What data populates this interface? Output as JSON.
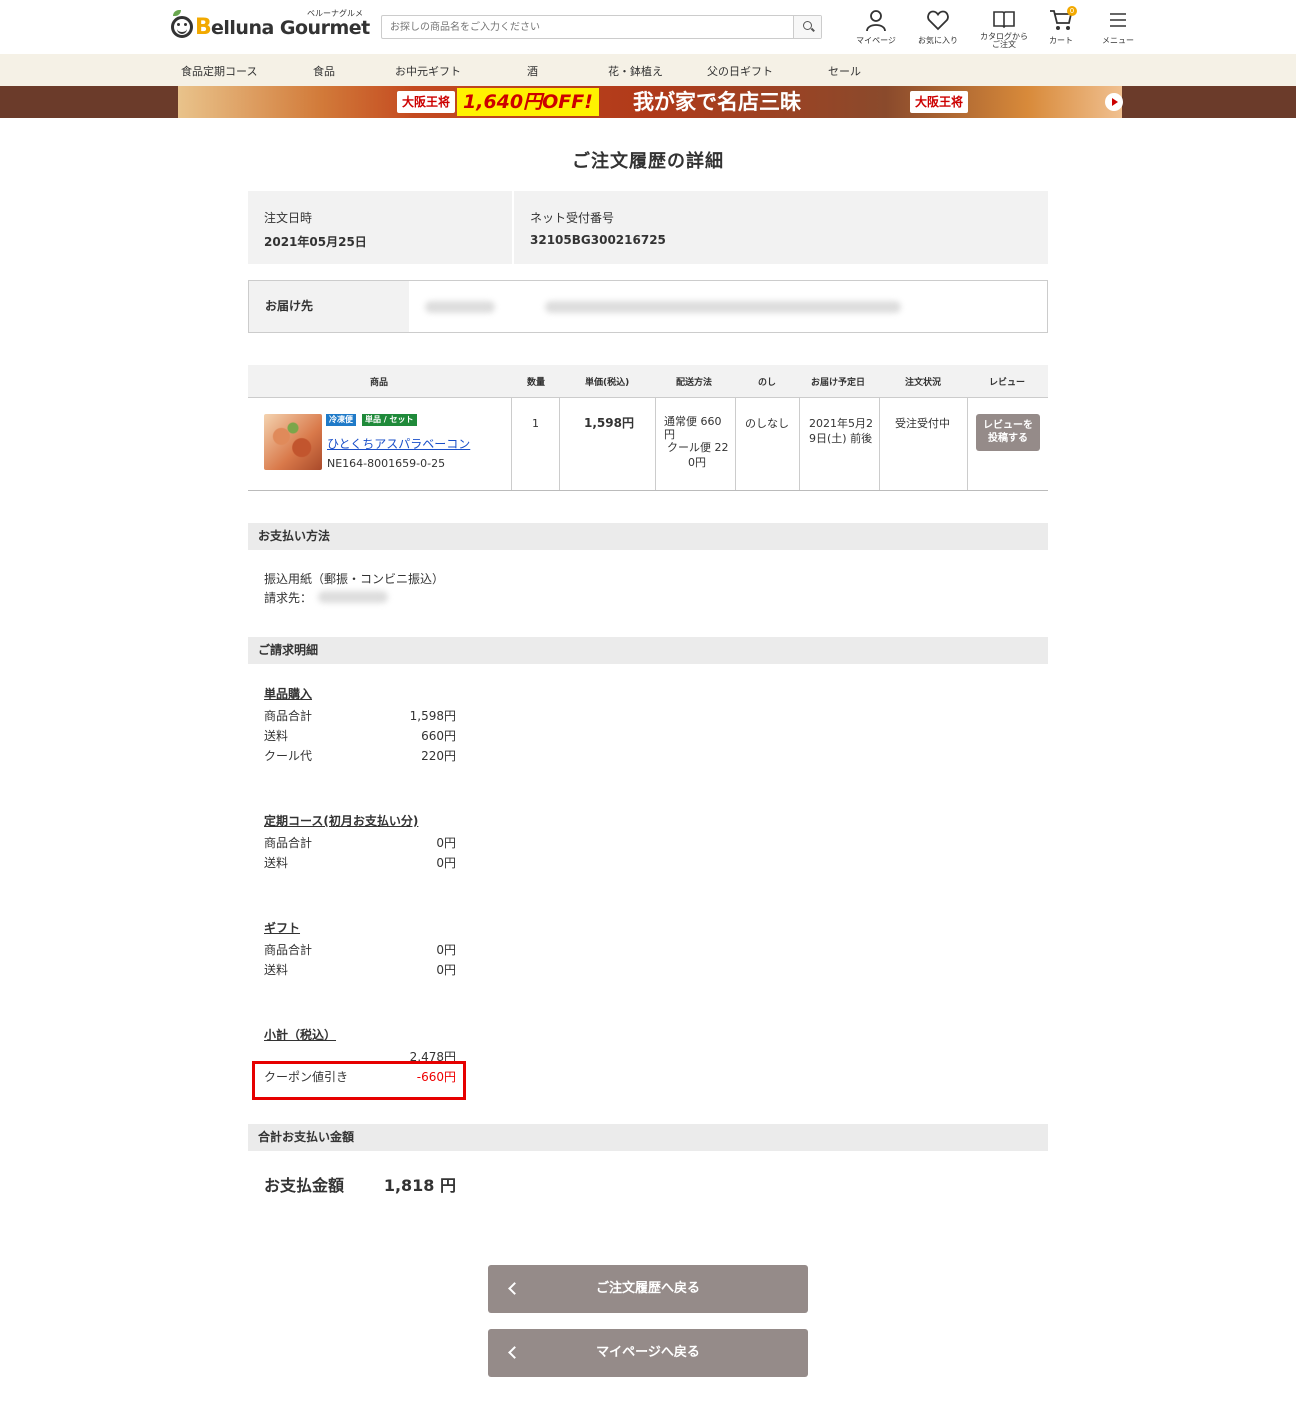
{
  "header": {
    "logo_text": "elluna Gourmet",
    "logo_b": "B",
    "logo_kana": "ベルーナグルメ",
    "search_placeholder": "お探しの商品名をご入力ください",
    "icons": {
      "mypage": "マイページ",
      "favorite": "お気に入り",
      "catalog_line1": "カタログから",
      "catalog_line2": "ご注文",
      "cart": "カート",
      "cart_count": "0",
      "menu": "メニュー"
    }
  },
  "category_nav": [
    "食品定期コース",
    "食品",
    "お中元ギフト",
    "酒",
    "花・鉢植え",
    "父の日ギフト",
    "セール"
  ],
  "banner": {
    "badge1": "大阪王将",
    "off_text": "1,640円OFF!",
    "title": "我が家で名店三昧",
    "badge2": "大阪王将"
  },
  "page_title": "ご注文履歴の詳細",
  "order_info": {
    "date_label": "注文日時",
    "date_value": "2021年05月25日",
    "number_label": "ネット受付番号",
    "number_value": "32105BG300216725"
  },
  "delivery": {
    "label": "お届け先"
  },
  "order_table": {
    "headers": [
      "商品",
      "数量",
      "単価(税込)",
      "配送方法",
      "のし",
      "お届け予定日",
      "注文状況",
      "レビュー"
    ],
    "item": {
      "tag1": "冷凍便",
      "tag2": "単品 / セット",
      "name": "ひとくちアスパラベーコン",
      "code": "NE164-8001659-0-25",
      "qty": "1",
      "price": "1,598円",
      "shipping_line1": "通常便 660",
      "shipping_line2": "円",
      "shipping_line3": "クール便 22",
      "shipping_line4": "0円",
      "noshi": "のしなし",
      "date_line1": "2021年5月2",
      "date_line2": "9日(土) 前後",
      "status": "受注受付中",
      "review_line1": "レビューを",
      "review_line2": "投稿する"
    }
  },
  "payment": {
    "heading": "お支払い方法",
    "method": "振込用紙（郵振・コンビニ振込）",
    "billing_label": "請求先："
  },
  "billing": {
    "heading": "ご請求明細",
    "single": {
      "title": "単品購入",
      "rows": [
        {
          "label": "商品合計",
          "value": "1,598円"
        },
        {
          "label": "送料",
          "value": "660円"
        },
        {
          "label": "クール代",
          "value": "220円"
        }
      ]
    },
    "subscription": {
      "title": "定期コース(初月お支払い分)",
      "rows": [
        {
          "label": "商品合計",
          "value": "0円"
        },
        {
          "label": "送料",
          "value": "0円"
        }
      ]
    },
    "gift": {
      "title": "ギフト",
      "rows": [
        {
          "label": "商品合計",
          "value": "0円"
        },
        {
          "label": "送料",
          "value": "0円"
        }
      ]
    },
    "subtotal": {
      "title": "小計（税込）",
      "value": "2,478円",
      "coupon_label": "クーポン値引き",
      "coupon_value": "-660円"
    }
  },
  "total": {
    "heading": "合計お支払い金額",
    "label": "お支払金額",
    "value": "1,818 円"
  },
  "buttons": {
    "history": "ご注文履歴へ戻る",
    "mypage": "マイページへ戻る"
  }
}
